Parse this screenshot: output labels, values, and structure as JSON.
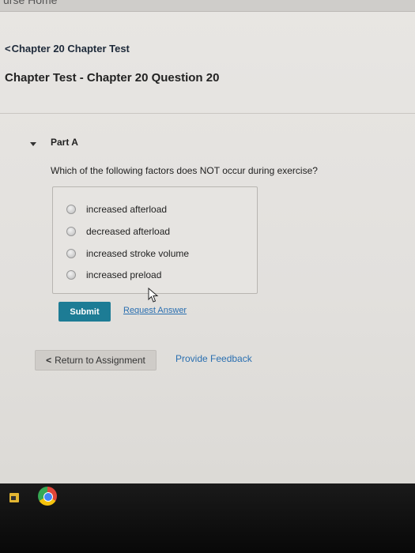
{
  "header": {
    "banner_text": "urse Home",
    "breadcrumb": "Chapter 20 Chapter Test",
    "title": "Chapter Test - Chapter 20 Question 20"
  },
  "part": {
    "label": "Part A",
    "prompt": "Which of the following factors does NOT occur during exercise?",
    "options": [
      {
        "label": "increased afterload"
      },
      {
        "label": "decreased afterload"
      },
      {
        "label": "increased stroke volume"
      },
      {
        "label": "increased preload"
      }
    ]
  },
  "actions": {
    "submit_label": "Submit",
    "request_answer_label": "Request Answer",
    "return_label": "Return to Assignment",
    "feedback_label": "Provide Feedback"
  },
  "taskbar": {
    "icons": [
      "file-explorer-icon",
      "chrome-icon"
    ]
  }
}
